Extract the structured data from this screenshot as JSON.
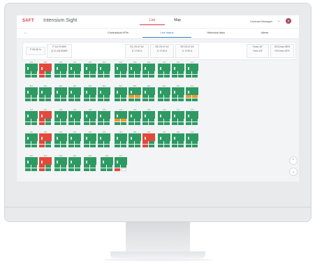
{
  "header": {
    "logo": "SAFT",
    "app_title": "Intensium Sight",
    "nav": [
      {
        "label": "List",
        "active": true
      },
      {
        "label": "Map",
        "active": false
      }
    ],
    "user": "Contract Manager",
    "user_chevron": "chevron-down-icon",
    "brand_logo": "totalenergies-logo"
  },
  "subnav": {
    "back_icon": "back-arrow-icon",
    "tabs": [
      {
        "label": "Contractual KPIs",
        "active": false
      },
      {
        "label": "Live status",
        "active": true
      },
      {
        "label": "Historical data",
        "active": false
      },
      {
        "label": "Alerts",
        "active": false
      }
    ]
  },
  "summary": {
    "boxes": [
      {
        "lines": [
          "P 95.96 %"
        ]
      },
      {
        "lines": [
          "P 16.79 MW",
          "Q 21.28 MVAR"
        ]
      },
      {
        "lines": [
          "SC 29.47 kV",
          "U 1749 A"
        ]
      },
      {
        "lines": [
          "SE 29.47 kV",
          "U 1749 A"
        ]
      },
      {
        "lines": [
          "SE 29.47 kV",
          "U 1749 A"
        ]
      },
      {
        "lines": [
          "Tmax 34°",
          "Tmin 18°"
        ]
      },
      {
        "lines": [
          "SOCmax 85%",
          "SOCmin 42%"
        ]
      }
    ]
  },
  "tile_rows": [
    {
      "labels": [
        "A01",
        "A02",
        "A03",
        "A04",
        "A05",
        "A06",
        "A07",
        "A08",
        "A09",
        "A10",
        "A11",
        "A12"
      ],
      "status": [
        "g",
        "r",
        "g",
        "g",
        "g",
        "g",
        "g",
        "g",
        "g",
        "g",
        "g",
        "g"
      ]
    },
    {
      "labels": [
        "B01",
        "B02",
        "B03",
        "B04",
        "B05",
        "B06",
        "B07",
        "B08",
        "B09",
        "B10",
        "B11",
        "B12"
      ],
      "status": [
        "g",
        "g",
        "g",
        "g",
        "g",
        "g",
        "g",
        "o",
        "g",
        "g",
        "g",
        "o"
      ]
    },
    {
      "labels": [
        "C01",
        "C02",
        "C03",
        "C04",
        "C05",
        "C06",
        "C07",
        "C08",
        "C09",
        "C10",
        "C11",
        "C12"
      ],
      "status": [
        "g",
        "r",
        "g",
        "g",
        "g",
        "g",
        "o",
        "g",
        "g",
        "g",
        "g",
        "g"
      ]
    },
    {
      "labels": [
        "D01",
        "D02",
        "D03",
        "D04",
        "D05",
        "D06",
        "D07",
        "D08",
        "D09",
        "D10",
        "D11",
        "D12"
      ],
      "status": [
        "g",
        "r",
        "g",
        "g",
        "g",
        "g",
        "g",
        "g",
        "r",
        "g",
        "g",
        "g"
      ]
    },
    {
      "labels": [
        "E01",
        "E02",
        "E03",
        "E04",
        "E05",
        "E06",
        "E07"
      ],
      "status": [
        "g",
        "r",
        "g",
        "g",
        "g",
        "g",
        "g"
      ]
    }
  ],
  "scroll_buttons": [
    {
      "icon": "chevron-up-icon"
    },
    {
      "icon": "chevron-down-icon"
    }
  ],
  "colors": {
    "green": "#2e9a63",
    "orange": "#e99a2a",
    "red": "#e2493b",
    "accent": "#2a7fc9",
    "brand": "#e2323f"
  }
}
